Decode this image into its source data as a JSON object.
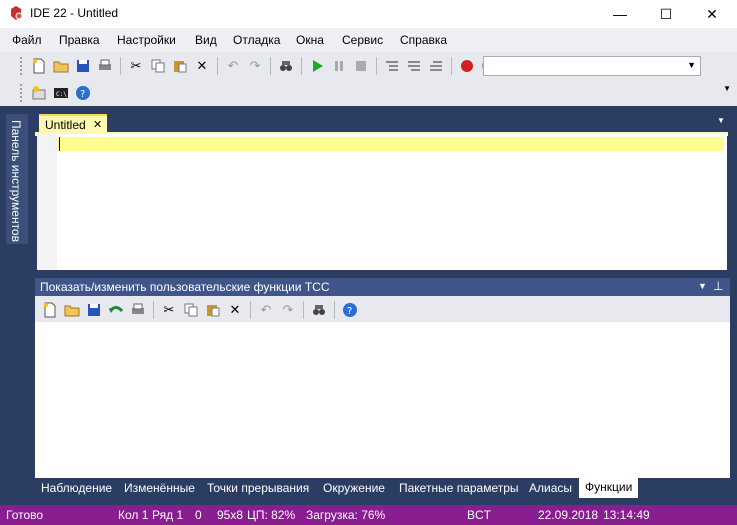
{
  "window": {
    "title": "IDE 22 - Untitled",
    "minimize": "—",
    "maximize": "☐",
    "close": "✕"
  },
  "menu": [
    "Файл",
    "Правка",
    "Настройки",
    "Вид",
    "Отладка",
    "Окна",
    "Сервис",
    "Справка"
  ],
  "toolbar": {
    "combo_value": ""
  },
  "left_panel": {
    "label": "Панель инструментов"
  },
  "document": {
    "tab_label": "Untitled",
    "tab_close": "✕"
  },
  "panel": {
    "title": "Показать/изменить пользовательские функции TCC"
  },
  "bottom_tabs": [
    "Наблюдение",
    "Изменённые",
    "Точки прерывания",
    "Окружение",
    "Пакетные параметры",
    "Алиасы",
    "Функции"
  ],
  "status": {
    "ready": "Готово",
    "col": "Кол 1",
    "row": "Ряд 1",
    "zero": "0",
    "size": "95x8",
    "cpu": "ЦП: 82%",
    "load": "Загрузка: 76%",
    "mode": "BCT",
    "date": "22.09.2018",
    "time": "13:14:49"
  },
  "colors": {
    "accent": "#2b3d63",
    "status": "#8a1d8f",
    "tab": "#fff8b0",
    "run": "#22a829",
    "record": "#d42020"
  }
}
